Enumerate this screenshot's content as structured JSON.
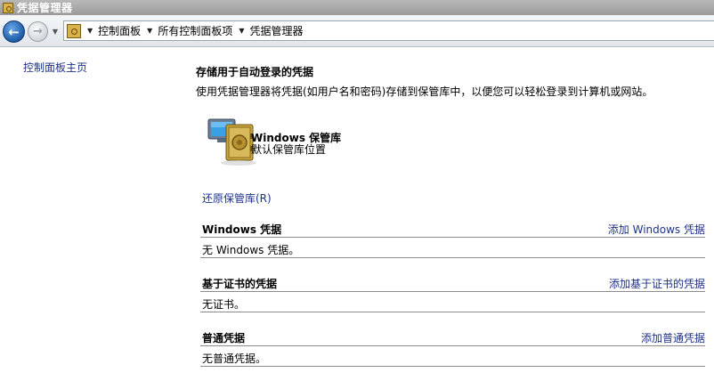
{
  "window": {
    "title": "凭据管理器"
  },
  "navbar": {
    "breadcrumbs": [
      "控制面板",
      "所有控制面板项",
      "凭据管理器"
    ]
  },
  "sidebar": {
    "home_link": "控制面板主页"
  },
  "main": {
    "title": "存储用于自动登录的凭据",
    "description": "使用凭据管理器将凭据(如用户名和密码)存储到保管库中，以便您可以轻松登录到计算机或网站。",
    "vault": {
      "name": "Windows 保管库",
      "subtitle": "默认保管库位置"
    },
    "restore_link": "还原保管库(R)",
    "sections": [
      {
        "title": "Windows 凭据",
        "action": "添加 Windows 凭据",
        "empty_text": "无 Windows 凭据。"
      },
      {
        "title": "基于证书的凭据",
        "action": "添加基于证书的凭据",
        "empty_text": "无证书。"
      },
      {
        "title": "普通凭据",
        "action": "添加普通凭据",
        "empty_text": "无普通凭据。"
      }
    ]
  },
  "colors": {
    "link": "#1e3287",
    "titlebar": "#a8a8a8",
    "divider": "#8c8c8c"
  },
  "icons": [
    "credential-manager-icon",
    "back-arrow-icon",
    "forward-arrow-icon",
    "dropdown-arrow-icon",
    "vault-icon"
  ]
}
